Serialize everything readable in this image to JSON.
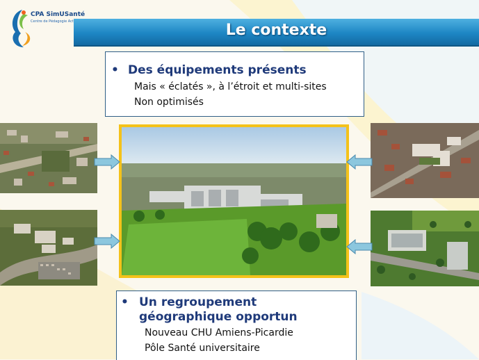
{
  "logo": {
    "name": "CPA SimUSanté",
    "tagline": "Centre de Pédagogie Active"
  },
  "title": "Le contexte",
  "box1": {
    "heading": "Des équipements présents",
    "lines": [
      "Mais  « éclatés », à l’étroit et multi-sites",
      "Non optimisés"
    ]
  },
  "box2": {
    "heading_line1": "Un regroupement",
    "heading_line2": "géographique opportun",
    "lines": [
      "Nouveau CHU Amiens-Picardie",
      "Pôle Santé universitaire"
    ]
  },
  "bullet": "•",
  "colors": {
    "title_bar": "#1d86c4",
    "heading": "#1f3a7a",
    "frame": "#f4c21a",
    "arrow": "#8cc7de"
  },
  "icons": {
    "arrow": "right-arrow-icon"
  }
}
